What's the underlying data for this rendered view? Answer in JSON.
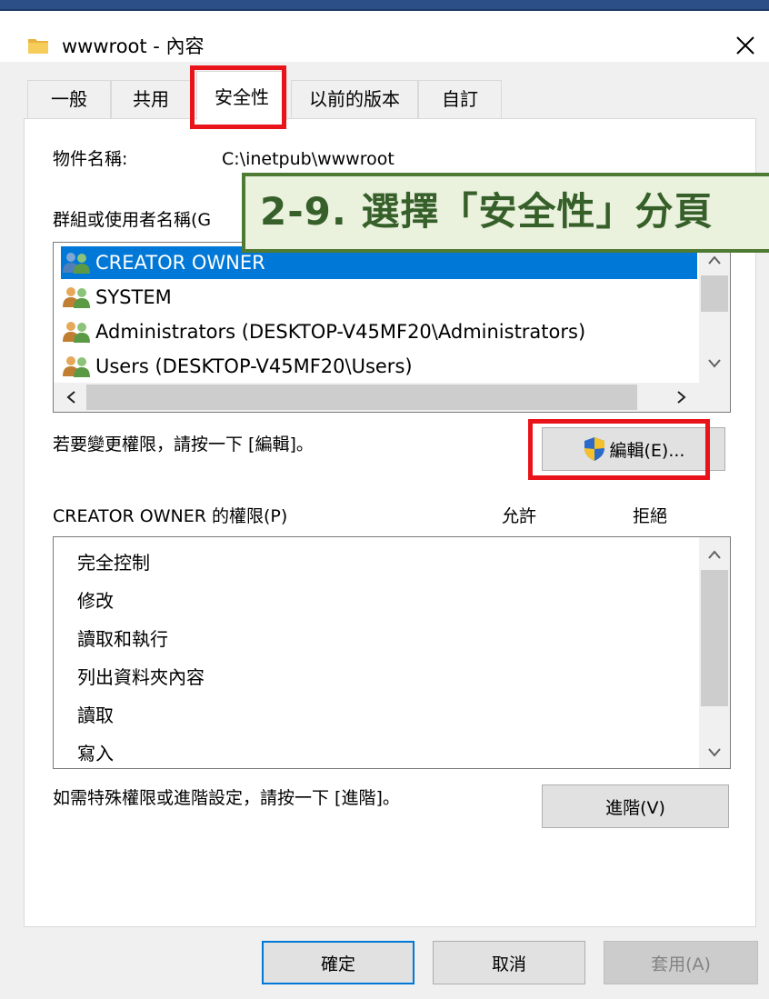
{
  "window": {
    "title": "wwwroot - 內容",
    "close_label": "✕"
  },
  "tabs": [
    {
      "label": "一般"
    },
    {
      "label": "共用"
    },
    {
      "label": "安全性"
    },
    {
      "label": "以前的版本"
    },
    {
      "label": "自訂"
    }
  ],
  "object": {
    "label": "物件名稱:",
    "value": "C:\\inetpub\\wwwroot"
  },
  "groups": {
    "label": "群組或使用者名稱(G",
    "items": [
      {
        "name": "CREATOR OWNER"
      },
      {
        "name": "SYSTEM"
      },
      {
        "name": "Administrators (DESKTOP-V45MF20\\Administrators)"
      },
      {
        "name": "Users (DESKTOP-V45MF20\\Users)"
      }
    ]
  },
  "annotation": {
    "text": "2-9. 選擇「安全性」分頁"
  },
  "edit": {
    "hint": "若要變更權限，請按一下 [編輯]。",
    "button_label": "編輯(E)..."
  },
  "permissions": {
    "header": "CREATOR OWNER 的權限(P)",
    "allow": "允許",
    "deny": "拒絕",
    "items": [
      "完全控制",
      "修改",
      "讀取和執行",
      "列出資料夾內容",
      "讀取",
      "寫入"
    ]
  },
  "advanced": {
    "hint": "如需特殊權限或進階設定，請按一下 [進階]。",
    "button_label": "進階(V)"
  },
  "buttons": {
    "ok": "確定",
    "cancel": "取消",
    "apply": "套用(A)"
  },
  "colors": {
    "selection": "#0078d7",
    "highlight": "#e8141a",
    "annotation_bg": "#eaf1dd",
    "annotation_border": "#4f7a33",
    "annotation_text": "#365f2a"
  }
}
